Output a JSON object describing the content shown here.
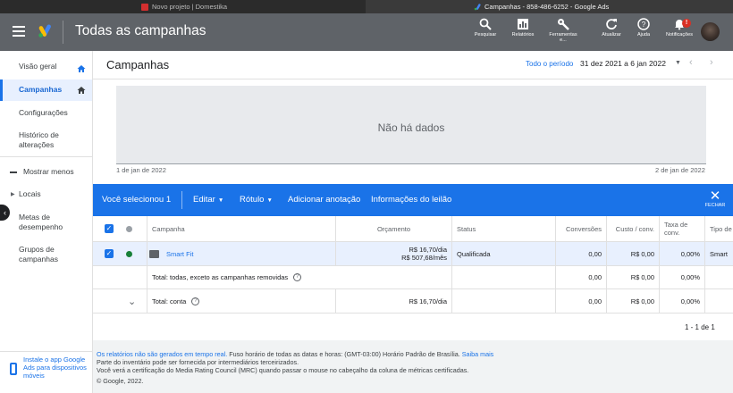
{
  "browser": {
    "tab1_title": "Novo projeto | Domestika",
    "tab2_title": "Campanhas - 858-486-6252 - Google Ads"
  },
  "header": {
    "title": "Todas as campanhas",
    "buttons": {
      "search": "Pesquisar",
      "reports": "Relatórios",
      "tools": "Ferramentas e...",
      "refresh": "Atualizar",
      "help": "Ajuda",
      "notifications": "Notificações"
    },
    "notification_count": "!"
  },
  "sidebar": {
    "items": [
      {
        "label": "Visão geral"
      },
      {
        "label": "Campanhas"
      },
      {
        "label": "Configurações"
      },
      {
        "label": "Histórico de alterações"
      },
      {
        "label": "Mostrar menos"
      },
      {
        "label": "Locais"
      },
      {
        "label": "Metas de desempenho"
      },
      {
        "label": "Grupos de campanhas"
      }
    ],
    "app_promo": "Instale o app Google Ads para dispositivos móveis"
  },
  "page": {
    "title": "Campanhas",
    "period_label": "Todo o período",
    "period_value": "31 dez 2021 a 6 jan 2022"
  },
  "chart": {
    "no_data": "Não há dados",
    "start_date": "1 de jan de 2022",
    "end_date": "2 de jan de 2022"
  },
  "selection_bar": {
    "selected": "Você selecionou 1",
    "edit": "Editar",
    "label": "Rótulo",
    "add_note": "Adicionar anotação",
    "auction_info": "Informações do leilão",
    "close": "FECHAR"
  },
  "table": {
    "headers": {
      "campaign": "Campanha",
      "budget": "Orçamento",
      "status": "Status",
      "conversions": "Conversões",
      "cost_conv": "Custo / conv.",
      "conv_rate": "Taxa de conv.",
      "campaign_type": "Tipo de campanha"
    },
    "rows": [
      {
        "campaign": "Smart Fit",
        "budget_day": "R$ 16,70/dia",
        "budget_month": "R$ 507,68/mês",
        "status": "Qualificada",
        "conversions": "0,00",
        "cost_conv": "R$ 0,00",
        "conv_rate": "0,00%",
        "campaign_type": "Smart"
      }
    ],
    "total_filtered": {
      "label": "Total: todas, exceto as campanhas removidas",
      "conversions": "0,00",
      "cost_conv": "R$ 0,00",
      "conv_rate": "0,00%"
    },
    "total_account": {
      "label": "Total: conta",
      "budget": "R$ 16,70/dia",
      "conversions": "0,00",
      "cost_conv": "R$ 0,00",
      "conv_rate": "0,00%"
    },
    "pagination": "1 - 1 de 1"
  },
  "footer": {
    "reports_link": "Os relatórios não são gerados em tempo real.",
    "timezone_text": "Fuso horário de todas as datas e horas: (GMT-03:00) Horário Padrão de Brasília.",
    "learn_more": "Saiba mais",
    "inventory": "Parte do inventário pode ser fornecida por intermediários terceirizados.",
    "mrc": "Você verá a certificação do Media Rating Council (MRC) quando passar o mouse no cabeçalho da coluna de métricas certificadas.",
    "copyright": "© Google, 2022."
  },
  "colors": {
    "accent": "#1a73e8",
    "header_bg": "#5f6368",
    "status_green": "#188038"
  }
}
